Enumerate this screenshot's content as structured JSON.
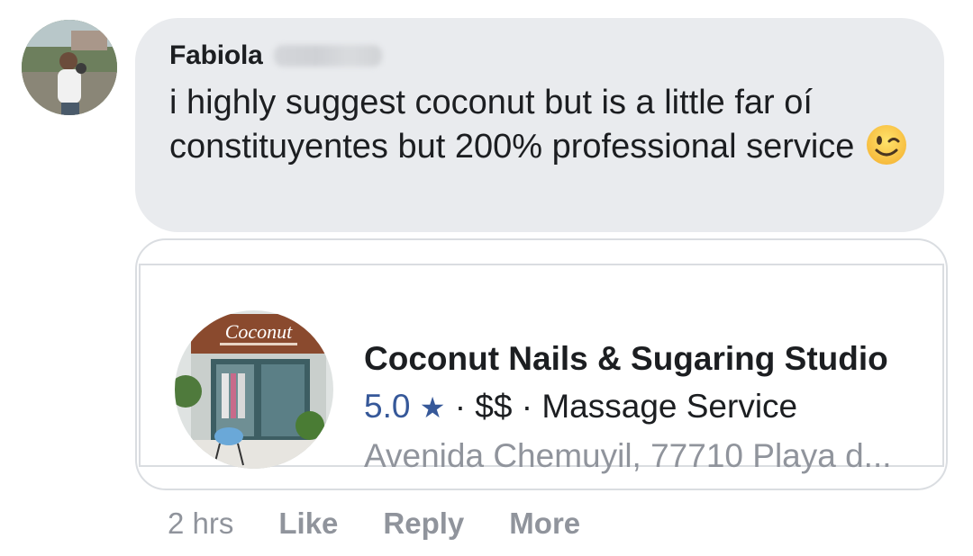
{
  "comment": {
    "author_name": "Fabiola",
    "text": "i highly suggest coconut but is a little far oí constituyentes but 200% professional service",
    "emoji_icon": "winking-face-emoji"
  },
  "link_preview": {
    "photo_sign_text": "Coconut",
    "title": "Coconut Nails & Sugaring Studio",
    "rating": "5.0",
    "star_icon": "★",
    "separator": "·",
    "price": "$$",
    "category": "Massage Service",
    "address": "Avenida Chemuyil, 77710 Playa d..."
  },
  "actions": {
    "timestamp": "2 hrs",
    "like": "Like",
    "reply": "Reply",
    "more": "More"
  },
  "colors": {
    "bubble_bg": "#e9ebee",
    "link_blue": "#365899",
    "muted_gray": "#90949c"
  }
}
